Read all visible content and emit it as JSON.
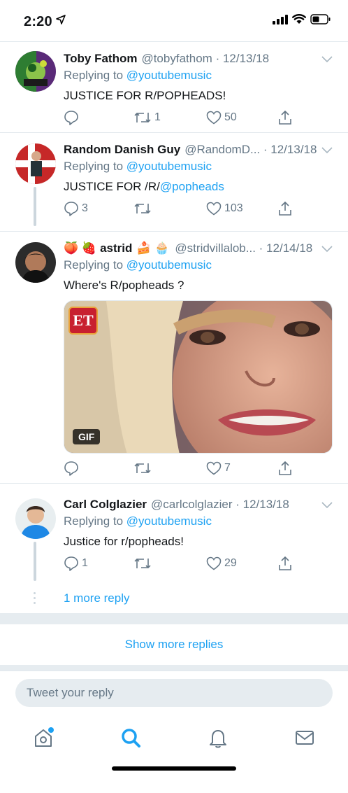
{
  "status_bar": {
    "time": "2:20"
  },
  "tweets": [
    {
      "name": "Toby Fathom",
      "handle": "@tobyfathom",
      "date": "· 12/13/18",
      "replying_prefix": "Replying to",
      "replying_to": "@youtubemusic",
      "text": "JUSTICE FOR R/POPHEADS!",
      "replies": "",
      "retweets": "1",
      "likes": "50"
    },
    {
      "name": "Random Danish Guy",
      "handle": "@RandomD...",
      "date": "· 12/13/18",
      "replying_prefix": "Replying to",
      "replying_to": "@youtubemusic",
      "text_prefix": "JUSTICE FOR /R/",
      "text_mention": "@popheads",
      "replies": "3",
      "retweets": "",
      "likes": "103"
    },
    {
      "name_emoji_prefix": "🍑 🍓",
      "name": "astrid",
      "name_emoji_suffix": "🍰 🧁",
      "handle": "@stridvillalob...",
      "date": "· 12/14/18",
      "replying_prefix": "Replying to",
      "replying_to": "@youtubemusic",
      "text": "Where's R/popheads ?",
      "media_badge": "GIF",
      "media_logo": "ET",
      "replies": "",
      "retweets": "",
      "likes": "7"
    },
    {
      "name": "Carl Colglazier",
      "handle": "@carlcolglazier",
      "date": "· 12/13/18",
      "replying_prefix": "Replying to",
      "replying_to": "@youtubemusic",
      "text": "Justice for r/popheads!",
      "replies": "1",
      "retweets": "",
      "likes": "29"
    }
  ],
  "more_reply": "1 more reply",
  "show_more_replies": "Show more replies",
  "reply_placeholder": "Tweet your reply",
  "colors": {
    "accent": "#1da1f2",
    "secondary_text": "#657786",
    "divider": "#e1e8ed"
  },
  "tab_icons": [
    "home-icon",
    "search-icon",
    "notifications-icon",
    "messages-icon"
  ]
}
